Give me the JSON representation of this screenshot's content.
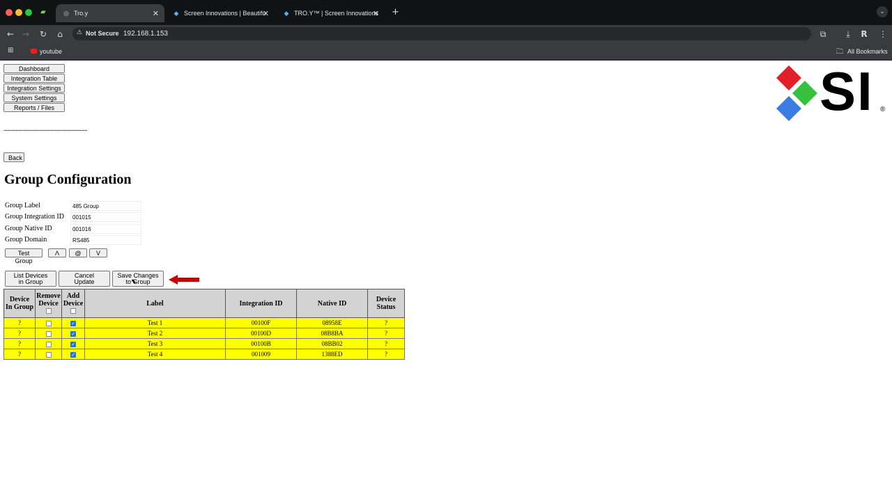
{
  "browser": {
    "tabs": [
      {
        "title": "Tro.y"
      },
      {
        "title": "Screen Innovations | Beautifu"
      },
      {
        "title": "TRO.Y™ | Screen Innovations"
      }
    ],
    "security_label": "Not Secure",
    "url": "192.168.1.153",
    "bookmarks": [
      {
        "label": "youtube"
      }
    ],
    "all_bookmarks_label": "All Bookmarks"
  },
  "nav": {
    "items": [
      {
        "label": "Dashboard"
      },
      {
        "label": "Integration Table"
      },
      {
        "label": "Integration Settings"
      },
      {
        "label": "System Settings"
      },
      {
        "label": "Reports / Files"
      }
    ],
    "separator": "------------------------------------------------"
  },
  "logo": {
    "text": "SI",
    "mark": "®",
    "colors": [
      "#e2202a",
      "#35c13e",
      "#3a7be4"
    ]
  },
  "back_label": "Back",
  "page_title": "Group Configuration",
  "form": {
    "fields": [
      {
        "label": "Group Label",
        "value": "485 Group"
      },
      {
        "label": "Group Integration ID",
        "value": "001015"
      },
      {
        "label": "Group Native ID",
        "value": "001016"
      },
      {
        "label": "Group Domain",
        "value": "RS485"
      }
    ],
    "test_group_label": "Test Group",
    "up_label": "Λ",
    "at_label": "@",
    "down_label": "V"
  },
  "actions": {
    "list_devices": [
      "List Devices",
      "in Group"
    ],
    "cancel_update": [
      "Cancel",
      "Update"
    ],
    "save_changes": [
      "Save Changes",
      "to Group"
    ]
  },
  "table": {
    "headers": [
      [
        "Device",
        "In Group"
      ],
      [
        "Remove",
        "Device"
      ],
      [
        "Add",
        "Device"
      ],
      [
        "Label"
      ],
      [
        "Integration ID"
      ],
      [
        "Native ID"
      ],
      [
        "Device",
        "Status"
      ]
    ],
    "rows": [
      {
        "in_group": "?",
        "remove": false,
        "add": true,
        "label": "Test 1",
        "integration_id": "00100F",
        "native_id": "08958E",
        "status": "?"
      },
      {
        "in_group": "?",
        "remove": false,
        "add": true,
        "label": "Test 2",
        "integration_id": "00100D",
        "native_id": "08B8BA",
        "status": "?"
      },
      {
        "in_group": "?",
        "remove": false,
        "add": true,
        "label": "Test 3",
        "integration_id": "00100B",
        "native_id": "08BB02",
        "status": "?"
      },
      {
        "in_group": "?",
        "remove": false,
        "add": true,
        "label": "Test 4",
        "integration_id": "001009",
        "native_id": "1388ED",
        "status": "?"
      }
    ],
    "row_color": "#ffff00"
  }
}
